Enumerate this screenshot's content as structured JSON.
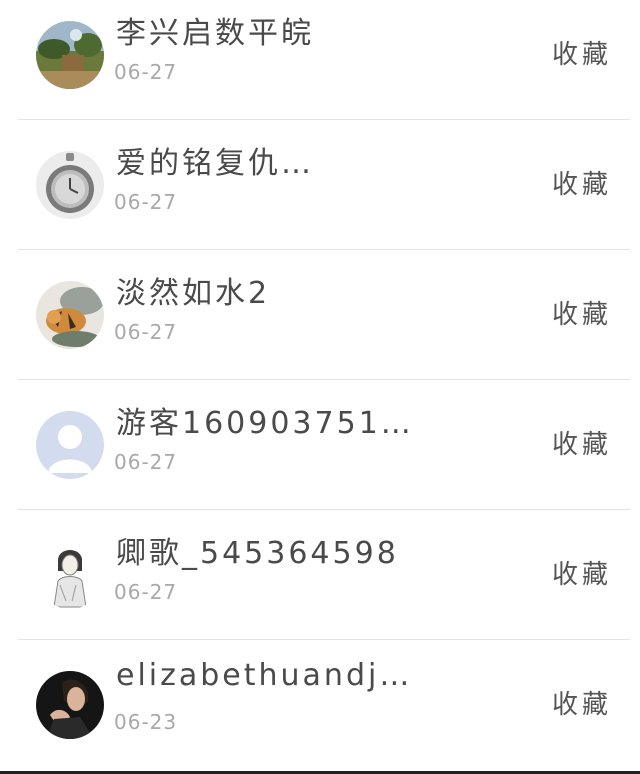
{
  "favorite_list": {
    "items": [
      {
        "name": "李兴启数平皖",
        "date": "06-27",
        "action": "收藏",
        "avatar_icon": "landscape-avatar-icon"
      },
      {
        "name": "爱的铭复仇…",
        "date": "06-27",
        "action": "收藏",
        "avatar_icon": "pocket-watch-avatar-icon"
      },
      {
        "name": "淡然如水2",
        "date": "06-27",
        "action": "收藏",
        "avatar_icon": "tiger-painting-avatar-icon"
      },
      {
        "name": "游客160903751…",
        "date": "06-27",
        "action": "收藏",
        "avatar_icon": "default-user-avatar-icon"
      },
      {
        "name": "卿歌_545364598",
        "date": "06-27",
        "action": "收藏",
        "avatar_icon": "sketch-girl-avatar-icon"
      },
      {
        "name": "elizabethuandj…",
        "date": "06-23",
        "action": "收藏",
        "avatar_icon": "dark-portrait-avatar-icon"
      }
    ]
  }
}
